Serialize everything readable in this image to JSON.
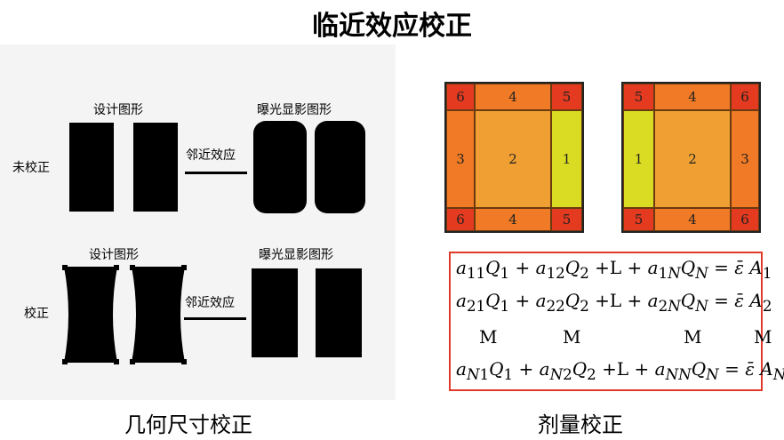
{
  "title": "临近效应校正",
  "geometry_section": {
    "design_label_top": "设计图形",
    "exposure_label_top": "曝光显影图形",
    "row_uncorrected": "未校正",
    "process_label_top": "邻近效应",
    "design_label_bottom": "设计图形",
    "exposure_label_bottom": "曝光显影图形",
    "row_corrected": "校正",
    "process_label_bottom": "邻近效应",
    "caption": "几何尺寸校正"
  },
  "dose_section": {
    "grid_left": {
      "top": [
        "6",
        "4",
        "5"
      ],
      "middle": [
        "3",
        "2",
        "1"
      ],
      "bottom": [
        "6",
        "4",
        "5"
      ]
    },
    "grid_right": {
      "top": [
        "5",
        "4",
        "6"
      ],
      "middle": [
        "1",
        "2",
        "3"
      ],
      "bottom": [
        "5",
        "4",
        "6"
      ]
    },
    "caption": "剂量校正"
  },
  "colors": {
    "corner": "#e43a1f",
    "edge": "#f07a25",
    "center": "#f0a033",
    "light": "#d9dc22",
    "equation_border": "#e23a2a"
  }
}
